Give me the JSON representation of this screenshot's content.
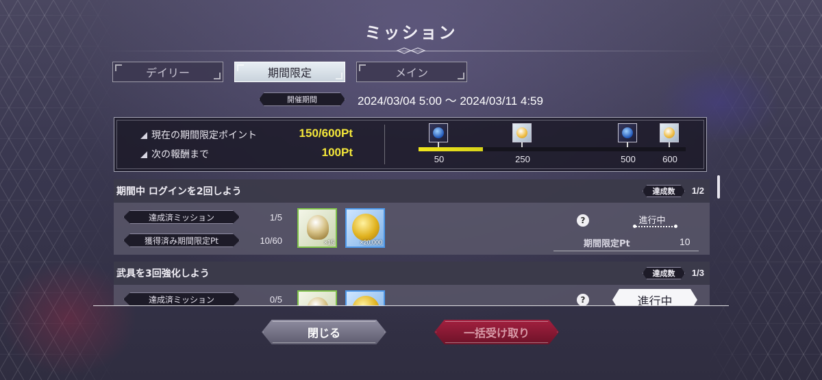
{
  "title": "ミッション",
  "tabs": [
    {
      "label": "デイリー",
      "active": false
    },
    {
      "label": "期間限定",
      "active": true
    },
    {
      "label": "メイン",
      "active": false
    }
  ],
  "period": {
    "badge": "開催期間",
    "range": "2024/03/04 5:00 〜 2024/03/11 4:59"
  },
  "points": {
    "current_label": "現在の期間限定ポイント",
    "current_value": "150/600Pt",
    "next_label": "次の報酬まで",
    "next_value": "100Pt",
    "progress_fraction": 0.24,
    "milestones": [
      {
        "value": "50",
        "icon": "blue-gem-icon"
      },
      {
        "value": "250",
        "icon": "gold-gem-icon"
      },
      {
        "value": "500",
        "icon": "blue-gem-icon"
      },
      {
        "value": "600",
        "icon": "gold-gem-icon"
      }
    ]
  },
  "missions": [
    {
      "title": "期間中 ログインを2回しよう",
      "count_badge": "達成数",
      "count": "1/2",
      "achieved_label": "達成済ミッション",
      "achieved_value": "1/5",
      "earned_label": "獲得済み期間限定Pt",
      "earned_value": "10/60",
      "rewards": [
        {
          "icon": "crystal-orb-icon",
          "qty": "×15"
        },
        {
          "icon": "gold-coin-icon",
          "qty": "×20,000"
        }
      ],
      "help": "?",
      "status": "進行中",
      "ltd_label": "期間限定Pt",
      "ltd_value": "10"
    },
    {
      "title": "武具を3回強化しよう",
      "count_badge": "達成数",
      "count": "1/3",
      "achieved_label": "達成済ミッション",
      "achieved_value": "0/5",
      "help": "?",
      "status": "進行中"
    }
  ],
  "buttons": {
    "close": "閉じる",
    "claim_all": "一括受け取り"
  },
  "colors": {
    "accent_yellow": "#f5e83a",
    "claim_red": "#8a1a34"
  }
}
